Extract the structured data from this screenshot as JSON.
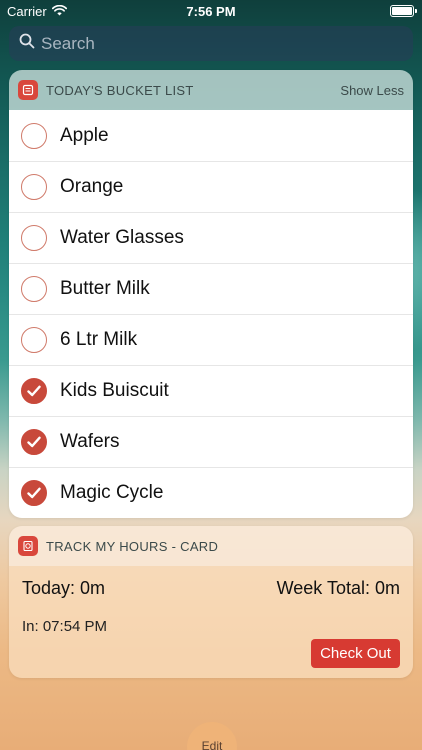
{
  "status_bar": {
    "carrier": "Carrier",
    "time": "7:56 PM",
    "icons": [
      "wifi-icon",
      "battery-icon"
    ]
  },
  "search": {
    "placeholder": "Search"
  },
  "bucket_widget": {
    "title": "TODAY'S BUCKET LIST",
    "action": "Show Less",
    "icon": "bucket-list-app-icon",
    "items": [
      {
        "label": "Apple",
        "checked": false
      },
      {
        "label": "Orange",
        "checked": false
      },
      {
        "label": "Water Glasses",
        "checked": false
      },
      {
        "label": "Butter Milk",
        "checked": false
      },
      {
        "label": "6 Ltr Milk",
        "checked": false
      },
      {
        "label": "Kids Buiscuit",
        "checked": true
      },
      {
        "label": "Wafers",
        "checked": true
      },
      {
        "label": "Magic Cycle",
        "checked": true
      }
    ]
  },
  "track_widget": {
    "title": "TRACK MY HOURS - CARD",
    "icon": "track-hours-app-icon",
    "today": "Today: 0m",
    "week_total": "Week Total: 0m",
    "in_time": "In: 07:54 PM",
    "checkout_label": "Check Out"
  },
  "edit_label": "Edit",
  "colors": {
    "accent_red": "#d73a32",
    "check_red": "#c8493b"
  }
}
